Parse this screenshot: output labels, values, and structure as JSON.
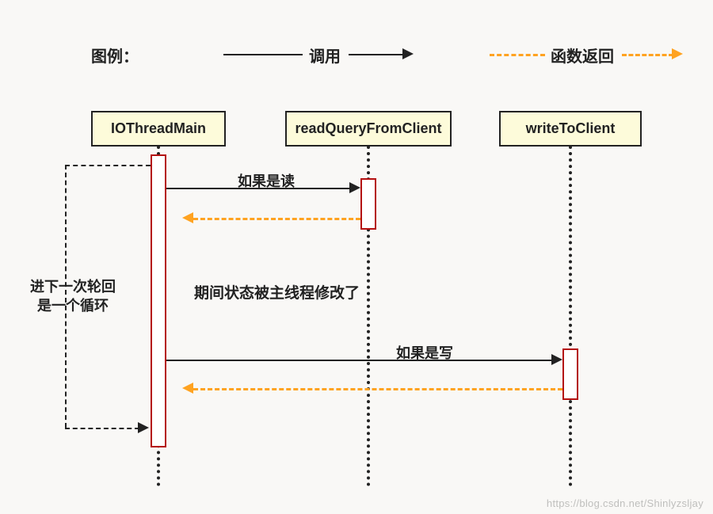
{
  "legend": {
    "title": "图例：",
    "call": "调用",
    "return": "函数返回"
  },
  "participants": {
    "io": "IOThreadMain",
    "read": "readQueryFromClient",
    "write": "writeToClient"
  },
  "messages": {
    "if_read": "如果是读",
    "mid_note": "期间状态被主线程修改了",
    "if_write": "如果是写"
  },
  "loop_note": {
    "line1": "进下一次轮回",
    "line2": "是一个循环"
  },
  "watermark": "https://blog.csdn.net/Shinlyzsljay",
  "chart_data": {
    "type": "sequence-diagram",
    "participants": [
      "IOThreadMain",
      "readQueryFromClient",
      "writeToClient"
    ],
    "messages": [
      {
        "from": "IOThreadMain",
        "to": "readQueryFromClient",
        "label": "如果是读",
        "kind": "call"
      },
      {
        "from": "readQueryFromClient",
        "to": "IOThreadMain",
        "label": "",
        "kind": "return"
      },
      {
        "from": "IOThreadMain",
        "to": "writeToClient",
        "label": "如果是写",
        "kind": "call"
      },
      {
        "from": "writeToClient",
        "to": "IOThreadMain",
        "label": "",
        "kind": "return"
      },
      {
        "from": "IOThreadMain",
        "to": "IOThreadMain",
        "label": "进下一次轮回 是一个循环",
        "kind": "self-loop"
      }
    ],
    "note": "期间状态被主线程修改了",
    "legend": {
      "call": "调用",
      "return": "函数返回"
    }
  }
}
